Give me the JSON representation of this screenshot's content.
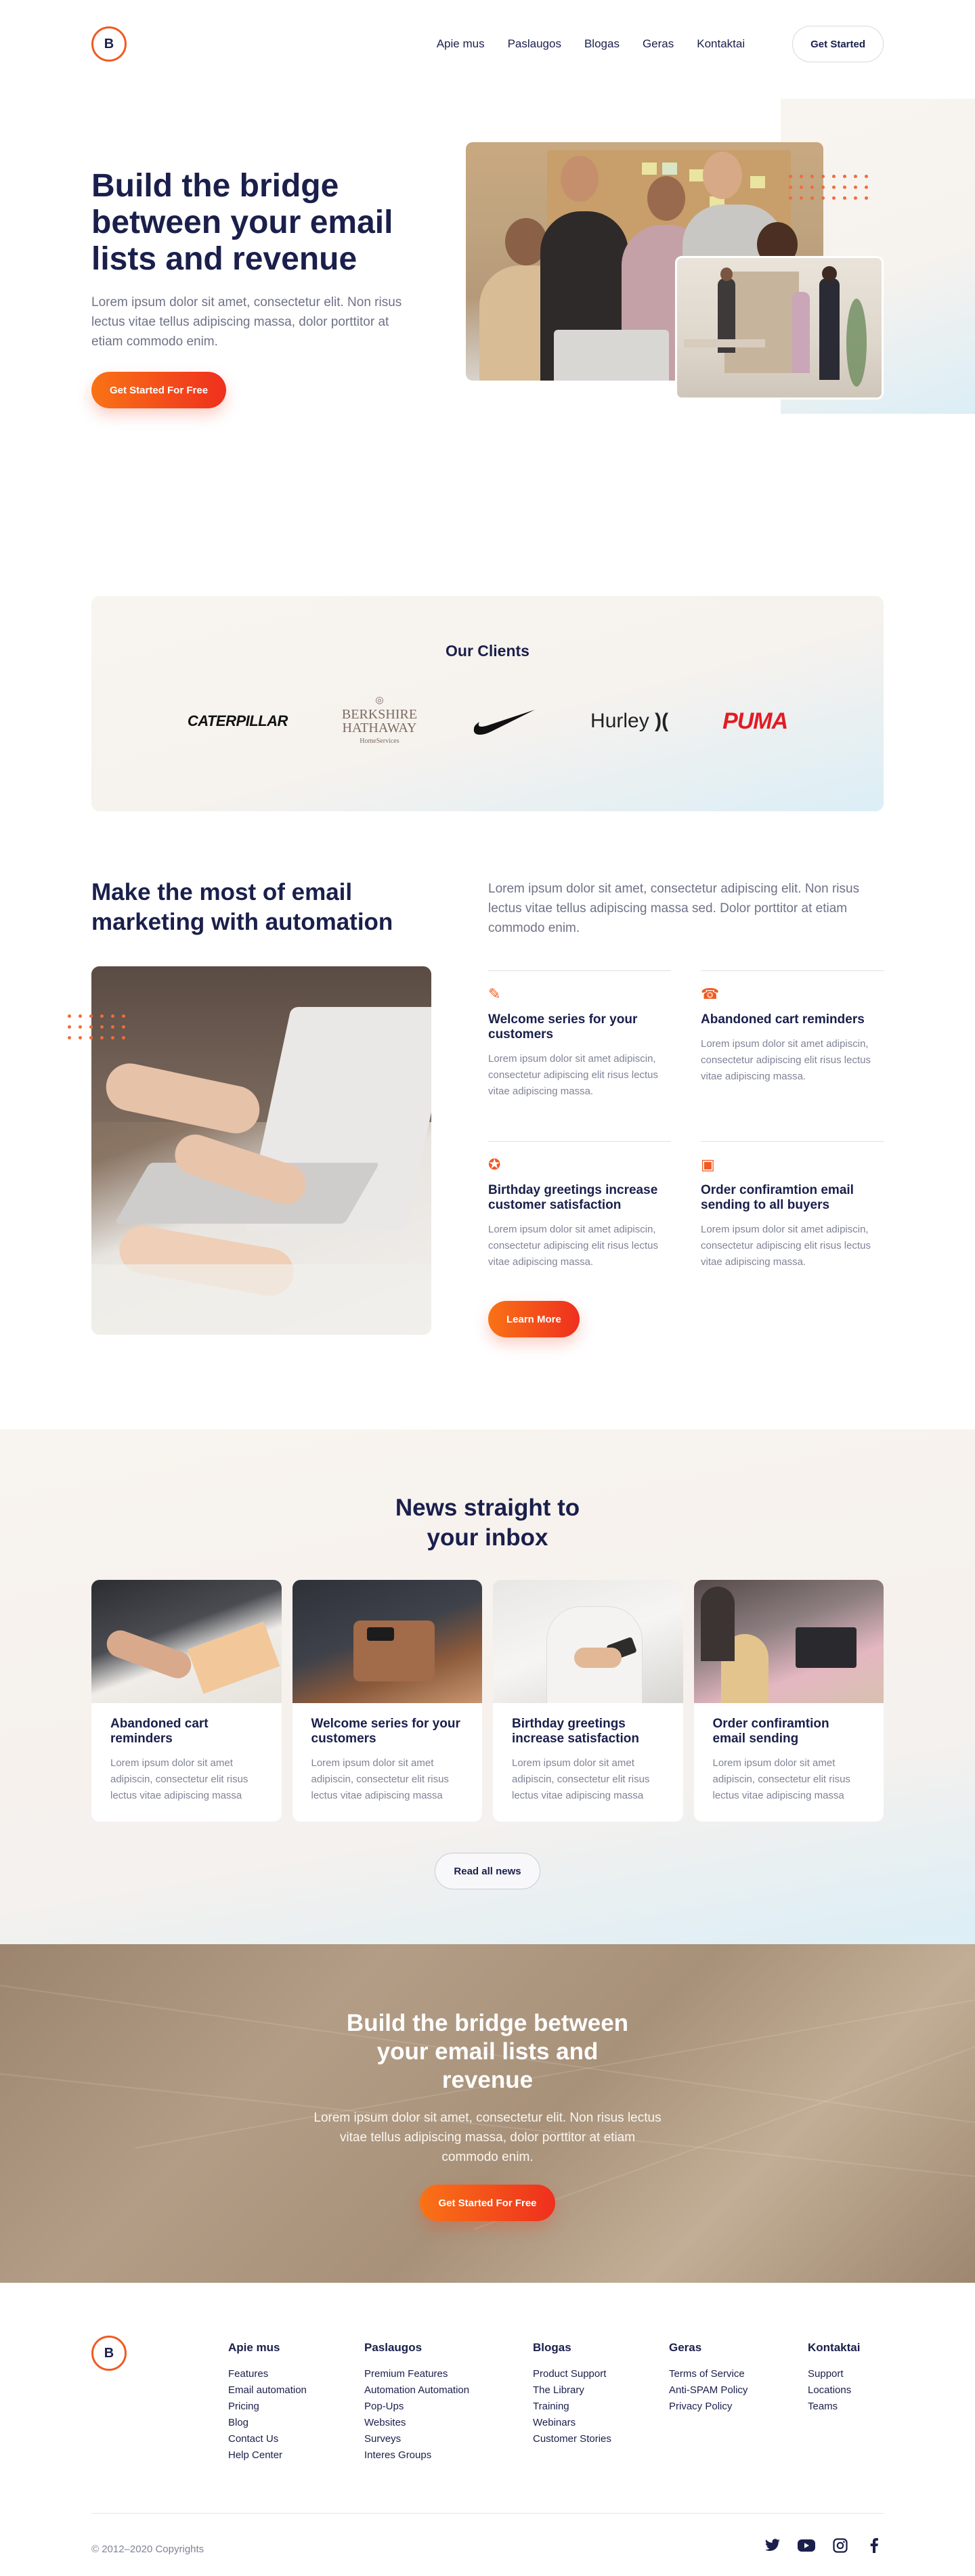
{
  "brand": {
    "logo_letter": "B",
    "accent": "#f15a22",
    "navy": "#1a1f4b"
  },
  "nav": {
    "items": [
      "Apie mus",
      "Paslaugos",
      "Blogas",
      "Geras",
      "Kontaktai"
    ],
    "cta_label": "Get Started"
  },
  "hero": {
    "title": "Build the bridge between your email lists and revenue",
    "description": "Lorem ipsum dolor sit amet, consectetur elit. Non risus lectus vitae tellus adipiscing massa, dolor porttitor at etiam commodo enim.",
    "cta_label": "Get Started For Free"
  },
  "clients": {
    "title": "Our Clients",
    "logos": [
      {
        "name": "caterpillar-logo",
        "text": "CATERPILLAR"
      },
      {
        "name": "berkshire-hathaway-logo",
        "line1": "BERKSHIRE",
        "line2": "HATHAWAY",
        "line3": "HomeServices"
      },
      {
        "name": "nike-logo",
        "text": "NIKE"
      },
      {
        "name": "hurley-logo",
        "text": "Hurley"
      },
      {
        "name": "puma-logo",
        "text": "PUMA"
      }
    ]
  },
  "automation": {
    "title": "Make the most of email marketing with automation",
    "description": "Lorem ipsum dolor sit amet, consectetur adipiscing elit. Non risus lectus vitae tellus adipiscing massa sed. Dolor porttitor at etiam commodo enim.",
    "features": [
      {
        "icon": "pencil-icon",
        "glyph": "✎",
        "title": "Welcome series for your customers",
        "text": "Lorem ipsum dolor sit amet adipiscin, consectetur adipiscing elit risus lectus vitae adipiscing massa."
      },
      {
        "icon": "phone-icon",
        "glyph": "☎",
        "title": "Abandoned cart reminders",
        "text": "Lorem ipsum dolor sit amet adipiscin, consectetur adipiscing elit risus lectus vitae adipiscing massa."
      },
      {
        "icon": "award-icon",
        "glyph": "✪",
        "title": "Birthday greetings increase customer satisfaction",
        "text": "Lorem ipsum dolor sit amet adipiscin, consectetur adipiscing elit risus lectus vitae adipiscing massa."
      },
      {
        "icon": "save-icon",
        "glyph": "▣",
        "title": "Order confiramtion email sending to all buyers",
        "text": "Lorem ipsum dolor sit amet adipiscin, consectetur adipiscing elit risus lectus vitae adipiscing massa."
      }
    ],
    "cta_label": "Learn More"
  },
  "news": {
    "title": "News straight to your inbox",
    "cards": [
      {
        "title": "Abandoned cart reminders",
        "text": "Lorem ipsum dolor sit amet adipiscin, consectetur elit risus lectus vitae adipiscing massa"
      },
      {
        "title": "Welcome series for your customers",
        "text": "Lorem ipsum dolor sit amet adipiscin, consectetur elit risus lectus vitae adipiscing massa"
      },
      {
        "title": "Birthday greetings increase satisfaction",
        "text": "Lorem ipsum dolor sit amet adipiscin, consectetur elit risus lectus vitae adipiscing massa"
      },
      {
        "title": "Order confiramtion email sending",
        "text": "Lorem ipsum dolor sit amet adipiscin, consectetur elit risus lectus vitae adipiscing massa"
      }
    ],
    "more_label": "Read all news"
  },
  "cta": {
    "title": "Build the bridge between your email lists and revenue",
    "description": "Lorem ipsum dolor sit amet, consectetur elit. Non risus lectus vitae tellus adipiscing massa, dolor porttitor at etiam commodo enim.",
    "button_label": "Get Started For Free"
  },
  "footer": {
    "columns": [
      {
        "title": "Apie mus",
        "links": [
          "Features",
          "Email automation",
          "Pricing",
          "Blog",
          "Contact Us",
          "Help Center"
        ]
      },
      {
        "title": "Paslaugos",
        "links": [
          "Premium Features",
          "Automation Automation",
          "Pop-Ups",
          "Websites",
          "Surveys",
          "Interes Groups"
        ]
      },
      {
        "title": "Blogas",
        "links": [
          "Product Support",
          "The Library",
          "Training",
          "Webinars",
          "Customer Stories"
        ]
      },
      {
        "title": "Geras",
        "links": [
          "Terms of Service",
          "Anti-SPAM Policy",
          "Privacy Policy"
        ]
      },
      {
        "title": "Kontaktai",
        "links": [
          "Support",
          "Locations",
          "Teams"
        ]
      }
    ],
    "copyright": "© 2012–2020 Copyrights",
    "socials": [
      "twitter-icon",
      "youtube-icon",
      "instagram-icon",
      "facebook-icon"
    ]
  }
}
